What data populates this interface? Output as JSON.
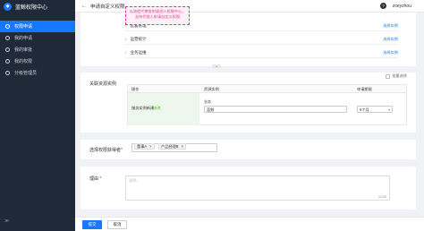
{
  "app": {
    "title": "蓝鲸权限中心",
    "logo_icon": "shield-icon"
  },
  "sidebar": {
    "items": [
      {
        "label": "权限申请",
        "active": true
      },
      {
        "label": "我的申请",
        "active": false
      },
      {
        "label": "我的审批",
        "active": false
      },
      {
        "label": "我的权限",
        "active": false
      },
      {
        "label": "分级管理员",
        "active": false
      }
    ],
    "collapse_label": "≫"
  },
  "header": {
    "back_icon": "←",
    "title": "申请自定义权限",
    "help_icon": "?",
    "user": "zoeyzhou"
  },
  "tooltip": {
    "line1": "以流程代审批申请进入权限中心，",
    "line2": "支持代他人申请自定义权限"
  },
  "permissions": {
    "rows": [
      {
        "label": "配置管理",
        "action": "选择实例"
      },
      {
        "label": "运营统计",
        "action": "选择实例"
      },
      {
        "label": "业务运维",
        "action": "选择实例"
      }
    ]
  },
  "related": {
    "section_label": "关联资源实例",
    "all_select_label": "批量选择",
    "columns": [
      "操作",
      "资源实例",
      "申请期限"
    ],
    "row": {
      "operation": "服务实例新建",
      "operation_link": "修改",
      "resource_label": "业务",
      "resource_value": "蓝鲸",
      "period": "6个月"
    }
  },
  "grantee": {
    "label": "选择权限获得者",
    "tags": [
      "董事A",
      "产品经理B"
    ]
  },
  "reason": {
    "label": "理由",
    "placeholder": "说明...",
    "count": "0/255"
  },
  "footer": {
    "submit": "提交",
    "cancel": "取消"
  },
  "colors": {
    "primary": "#1677ff",
    "sidebar": "#1f2937",
    "tooltip_border": "#eb2f96"
  }
}
